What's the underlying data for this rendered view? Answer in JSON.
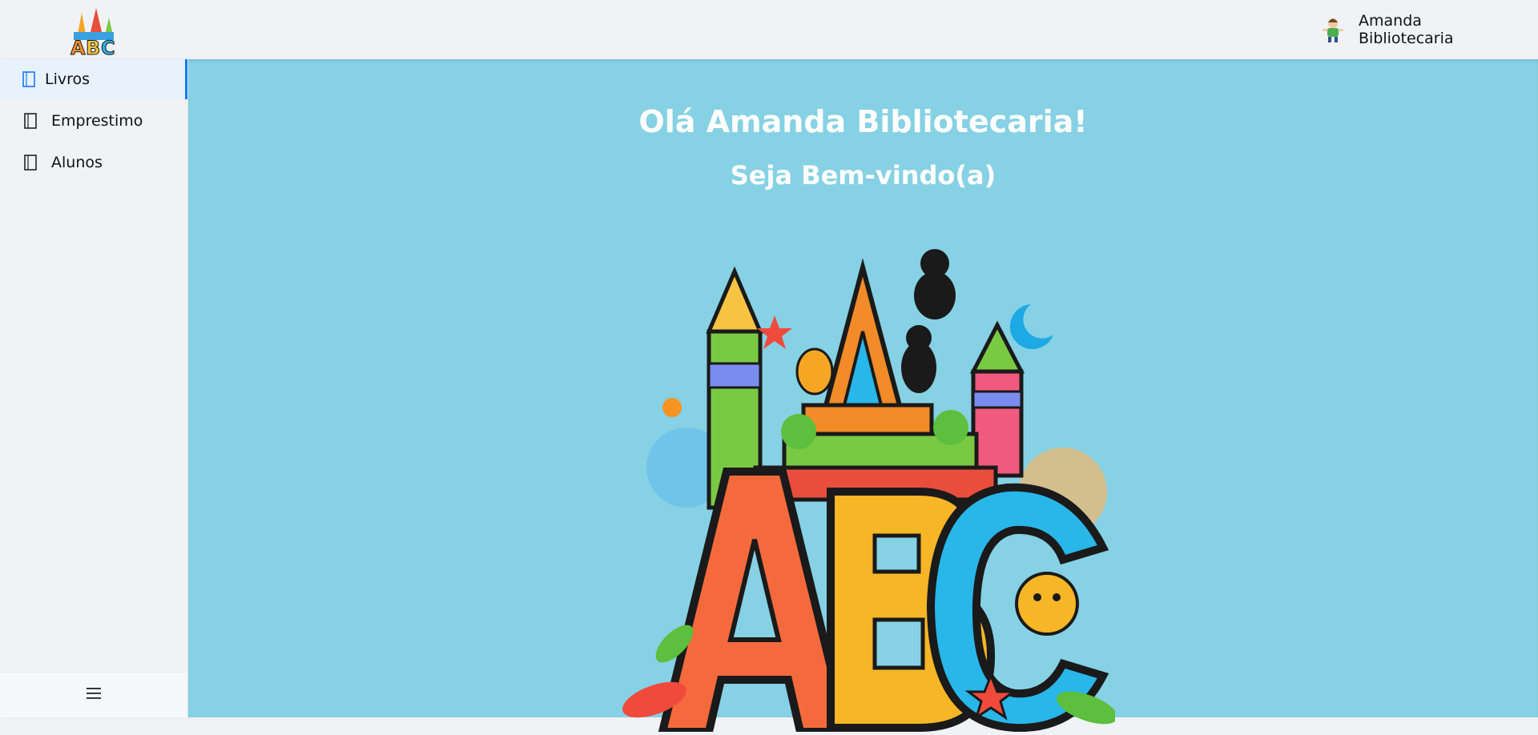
{
  "app": {
    "logo_icon": "abc-logo-icon"
  },
  "header": {
    "user": {
      "name": "Amanda Bibliotecaria",
      "avatar_icon": "user-avatar-icon"
    }
  },
  "sidebar": {
    "items": [
      {
        "label": "Livros",
        "icon": "book-icon",
        "active": true
      },
      {
        "label": "Emprestimo",
        "icon": "book-icon",
        "active": false
      },
      {
        "label": "Alunos",
        "icon": "book-icon",
        "active": false
      }
    ],
    "collapse_icon": "menu-icon"
  },
  "main": {
    "greeting": "Olá Amanda Bibliotecaria!",
    "welcome": "Seja Bem-vindo(a)",
    "illustration_icon": "abc-illustration"
  },
  "colors": {
    "main_background": "#86d1e4",
    "accent": "#1677ff",
    "sidebar_background": "#f0f2f5"
  }
}
